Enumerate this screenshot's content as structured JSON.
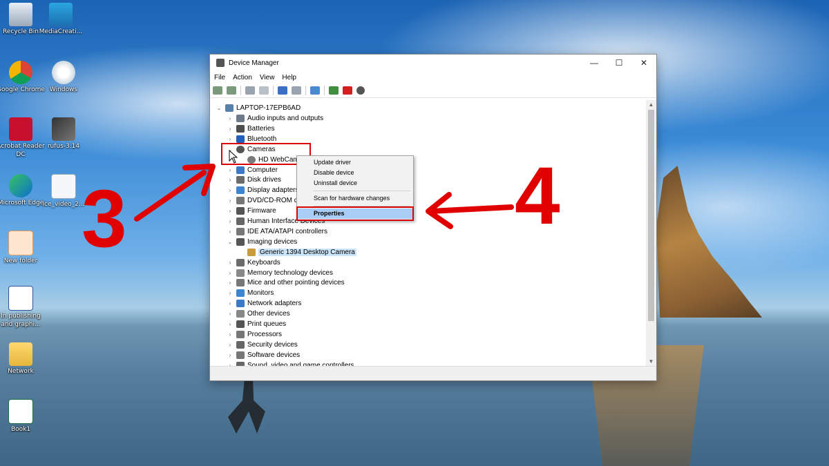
{
  "desktop_icons": [
    {
      "label": "Recycle Bin",
      "icon": "recycle-bin-icon"
    },
    {
      "label": "MediaCreati...",
      "icon": "media-creation-tool-icon"
    },
    {
      "label": "Google Chrome",
      "icon": "chrome-icon"
    },
    {
      "label": "Windows",
      "icon": "disc-image-icon"
    },
    {
      "label": "Acrobat Reader DC",
      "icon": "acrobat-icon"
    },
    {
      "label": "rufus-3.14",
      "icon": "rufus-icon"
    },
    {
      "label": "Microsoft Edge",
      "icon": "edge-icon"
    },
    {
      "label": "ice_video_2...",
      "icon": "video-file-icon"
    },
    {
      "label": "New folder",
      "icon": "pdf-file-icon"
    },
    {
      "label": "In publishing and graphi...",
      "icon": "word-doc-icon"
    },
    {
      "label": "Network",
      "icon": "folder-icon"
    },
    {
      "label": "Book1",
      "icon": "excel-file-icon"
    }
  ],
  "annotations": {
    "step_a": "3",
    "step_b": "4",
    "color": "#e00000"
  },
  "window": {
    "title": "Device Manager",
    "buttons": {
      "minimize": "—",
      "maximize": "☐",
      "close": "✕"
    },
    "menu": [
      "File",
      "Action",
      "View",
      "Help"
    ]
  },
  "tree": {
    "root": "LAPTOP-17EPB6AD",
    "items": [
      {
        "label": "Audio inputs and outputs",
        "expander": "›"
      },
      {
        "label": "Batteries",
        "expander": "›"
      },
      {
        "label": "Bluetooth",
        "expander": "›"
      },
      {
        "label": "Cameras",
        "expander": "⌄"
      },
      {
        "label": "HD WebCam",
        "expander": ""
      },
      {
        "label": "Computer",
        "expander": "›"
      },
      {
        "label": "Disk drives",
        "expander": "›"
      },
      {
        "label": "Display adapters",
        "expander": "›"
      },
      {
        "label": "DVD/CD-ROM drives",
        "expander": "›"
      },
      {
        "label": "Firmware",
        "expander": "›"
      },
      {
        "label": "Human Interface Devices",
        "expander": "›"
      },
      {
        "label": "IDE ATA/ATAPI controllers",
        "expander": "›"
      },
      {
        "label": "Imaging devices",
        "expander": "⌄"
      },
      {
        "label": "Generic 1394 Desktop Camera",
        "expander": ""
      },
      {
        "label": "Keyboards",
        "expander": "›"
      },
      {
        "label": "Memory technology devices",
        "expander": "›"
      },
      {
        "label": "Mice and other pointing devices",
        "expander": "›"
      },
      {
        "label": "Monitors",
        "expander": "›"
      },
      {
        "label": "Network adapters",
        "expander": "›"
      },
      {
        "label": "Other devices",
        "expander": "›"
      },
      {
        "label": "Print queues",
        "expander": "›"
      },
      {
        "label": "Processors",
        "expander": "›"
      },
      {
        "label": "Security devices",
        "expander": "›"
      },
      {
        "label": "Software devices",
        "expander": "›"
      },
      {
        "label": "Sound, video and game controllers",
        "expander": "›"
      }
    ]
  },
  "context_menu": {
    "items": [
      "Update driver",
      "Disable device",
      "Uninstall device",
      "Scan for hardware changes",
      "Properties"
    ],
    "selected": "Properties"
  }
}
